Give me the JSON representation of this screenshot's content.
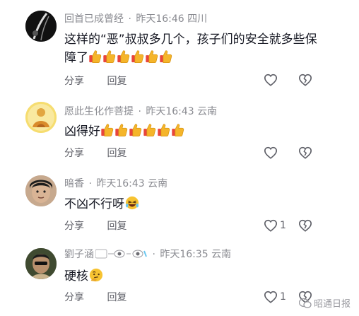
{
  "comments": [
    {
      "username": "回首已成曾经",
      "time": "昨天16:46",
      "location": "四川",
      "text": "这样的“恶”叔叔多几个，孩子们的安全就多些保障了",
      "emoji": "thumbs-up x6",
      "reply_actions": [
        "分享",
        "回复"
      ],
      "like_count": ""
    },
    {
      "username": "愿此生化作菩提",
      "time": "昨天16:43",
      "location": "云南",
      "text": "凶得好",
      "emoji": "thumbs-up x6",
      "reply_actions": [
        "分享",
        "回复"
      ],
      "like_count": ""
    },
    {
      "username": "暗香",
      "time": "昨天16:43",
      "location": "云南",
      "text": "不凶不行呀",
      "emoji": "laughing-face",
      "reply_actions": [
        "分享",
        "回复"
      ],
      "like_count": "1"
    },
    {
      "username": "劉子涵",
      "time": "昨天16:35",
      "location": "云南",
      "text": "硬核",
      "emoji": "thinking-face",
      "reply_actions": [
        "分享",
        "回复"
      ],
      "like_count": "1"
    }
  ],
  "watermark": "昭通日报",
  "colors": {
    "meta": "#8a8b91",
    "text": "#161823",
    "thumb": "#f5b52a",
    "thumb_cuff": "#e8453c"
  }
}
